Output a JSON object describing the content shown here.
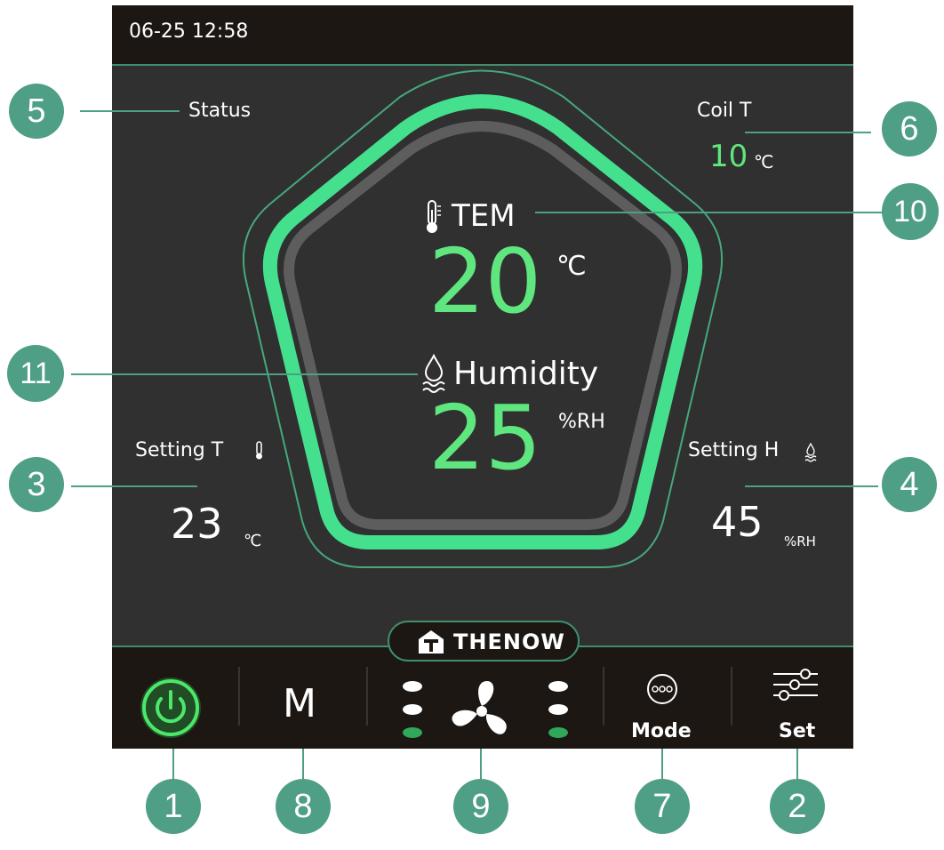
{
  "header": {
    "datetime": "06-25 12:58"
  },
  "status": {
    "label": "Status"
  },
  "coil": {
    "label": "Coil T",
    "value": "10",
    "unit": "℃"
  },
  "temperature": {
    "label": "TEM",
    "value": "20",
    "unit": "℃"
  },
  "humidity": {
    "label": "Humidity",
    "value": "25",
    "unit": "%RH"
  },
  "setting_t": {
    "label": "Setting T",
    "value": "23",
    "unit": "℃"
  },
  "setting_h": {
    "label": "Setting H",
    "value": "45",
    "unit": "%RH"
  },
  "brand": "THENOW",
  "bottom_bar": {
    "power_icon": "power-icon",
    "mode_letter": "M",
    "fan_icon": "fan-icon",
    "mode_label": "Mode",
    "set_label": "Set"
  },
  "callouts": [
    "1",
    "2",
    "3",
    "4",
    "5",
    "6",
    "7",
    "8",
    "9",
    "10",
    "11"
  ],
  "colors": {
    "screen_bg": "#303030",
    "bar_bg": "#1d1714",
    "accent_green": "#5fe67f",
    "callout_teal": "#4f9e86"
  }
}
